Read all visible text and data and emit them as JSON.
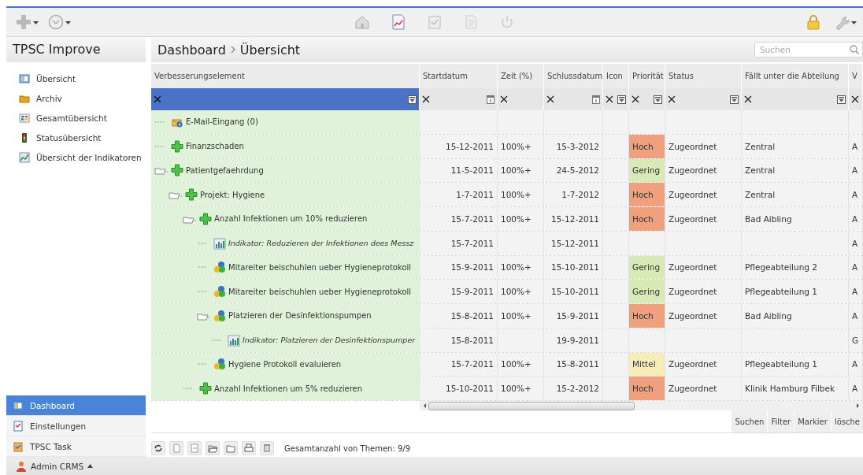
{
  "toolbar": {
    "left": [
      {
        "kind": "plus",
        "menu": true
      },
      {
        "kind": "clock",
        "menu": true
      }
    ],
    "center": [
      {
        "kind": "home"
      },
      {
        "kind": "chart"
      },
      {
        "kind": "clipboard"
      },
      {
        "kind": "document"
      },
      {
        "kind": "power"
      }
    ],
    "right": [
      {
        "kind": "lock",
        "menu": false
      },
      {
        "kind": "wrench",
        "menu": true
      }
    ]
  },
  "sidebar": {
    "title": "TPSC Improve",
    "items": [
      {
        "label": "Übersicht",
        "kind": "overview"
      },
      {
        "label": "Archiv",
        "kind": "archive"
      },
      {
        "label": "Gesamtübersicht",
        "kind": "grid"
      },
      {
        "label": "Statusübersicht",
        "kind": "traffic"
      },
      {
        "label": "Übersicht der Indikatoren",
        "kind": "chart"
      }
    ],
    "nav": [
      {
        "label": "Dashboard",
        "kind": "overview",
        "selected": true
      },
      {
        "label": "Einstellungen",
        "kind": "checklist",
        "selected": false
      },
      {
        "label": "TPSC Task",
        "kind": "task",
        "selected": false
      }
    ]
  },
  "breadcrumb": [
    "Dashboard",
    "Übersicht"
  ],
  "search": {
    "placeholder": "Suchen"
  },
  "table": {
    "columns": [
      {
        "label": "Verbesserungselement",
        "kind": "list",
        "selected": true
      },
      {
        "label": "Startdatum",
        "kind": "date",
        "selected": false
      },
      {
        "label": "Zeit (%)",
        "kind": "text",
        "selected": false
      },
      {
        "label": "Schlussdatum",
        "kind": "date",
        "selected": false
      },
      {
        "label": "Icon",
        "kind": "list",
        "selected": false
      },
      {
        "label": "Priorität",
        "kind": "list",
        "selected": false
      },
      {
        "label": "Status",
        "kind": "list",
        "selected": false
      },
      {
        "label": "Fällt unter die Abteilung",
        "kind": "list",
        "selected": false
      },
      {
        "label": "V",
        "kind": "text",
        "selected": false
      }
    ],
    "rows": [
      {
        "name": "E-Mail-Eingang (0)",
        "kind": "mail",
        "expanded": false
      },
      {
        "name": "Finanzschaden",
        "kind": "goal",
        "expanded": false,
        "start": "15-12-2011",
        "time": "100%+",
        "end": "15-3-2012",
        "priority": {
          "label": "Hoch",
          "color": "#f0a07c"
        },
        "status": "Zugeordnet",
        "department": "Zentral",
        "column_9": "A"
      },
      {
        "name": "Patientgefaehrdung",
        "kind": "goal",
        "expanded": true,
        "start": "11-5-2011",
        "time": "100%+",
        "end": "24-5-2012",
        "priority": {
          "label": "Gering",
          "color": "#d8eab6"
        },
        "status": "Zugeordnet",
        "department": "Zentral",
        "column_9": "A",
        "children": [
          {
            "name": "Projekt: Hygiene",
            "kind": "goal",
            "expanded": true,
            "start": "1-7-2011",
            "time": "100%+",
            "end": "1-7-2012",
            "priority": {
              "label": "Hoch",
              "color": "#f0a07c"
            },
            "status": "Zugeordnet",
            "department": "Zentral",
            "column_9": "A",
            "children": [
              {
                "name": "Anzahl Infektionen um 10% reduzieren",
                "kind": "goal",
                "expanded": true,
                "start": "15-7-2011",
                "time": "100%+",
                "end": "15-12-2011",
                "priority": {
                  "label": "Hoch",
                  "color": "#f0a07c"
                },
                "status": "Zugeordnet",
                "department": "Bad Aibling",
                "column_9": "A",
                "children": [
                  {
                    "name": "Indikator: Reduzieren der Infektionen dees Messz",
                    "kind": "indicator",
                    "expanded": false,
                    "start": "15-7-2011",
                    "end": "15-12-2011",
                    "column_9": "A"
                  },
                  {
                    "name": "Mitareiter beischuhlen ueber Hygieneprotokoll",
                    "kind": "task",
                    "expanded": false,
                    "start": "15-9-2011",
                    "time": "100%+",
                    "end": "15-10-2011",
                    "priority": {
                      "label": "Gering",
                      "color": "#d8eab6"
                    },
                    "status": "Zugeordnet",
                    "department": "Pflegeabteilung 2",
                    "column_9": "A"
                  },
                  {
                    "name": "Mitareiter beischuhlen ueber Hygieneprotokoll",
                    "kind": "task",
                    "expanded": false,
                    "start": "15-9-2011",
                    "time": "100%+",
                    "end": "15-10-2011",
                    "priority": {
                      "label": "Gering",
                      "color": "#d8eab6"
                    },
                    "status": "Zugeordnet",
                    "department": "Pflegeabteilung 1",
                    "column_9": "A"
                  },
                  {
                    "name": "Platzieren der Desinfektionspumpen",
                    "kind": "task",
                    "expanded": true,
                    "start": "15-8-2011",
                    "time": "100%+",
                    "end": "15-9-2011",
                    "priority": {
                      "label": "Hoch",
                      "color": "#f0a07c"
                    },
                    "status": "Zugeordnet",
                    "department": "Bad Aibling",
                    "column_9": "A",
                    "children": [
                      {
                        "name": "Indikator: Platzieren der Desinfektionspumper",
                        "kind": "indicator",
                        "expanded": false,
                        "start": "15-8-2011",
                        "end": "19-9-2011",
                        "column_9": "G"
                      }
                    ]
                  },
                  {
                    "name": "Hygiene Protokoll evaluieren",
                    "kind": "task",
                    "expanded": false,
                    "start": "15-7-2011",
                    "time": "100%+",
                    "end": "15-8-2011",
                    "priority": {
                      "label": "Mittel",
                      "color": "#f7edb8"
                    },
                    "status": "Zugeordnet",
                    "department": "Pflegeabteilung 1",
                    "column_9": "A"
                  }
                ]
              },
              {
                "name": "Anzahl Infektionen um 5% reduzieren",
                "kind": "goal",
                "expanded": false,
                "start": "15-10-2011",
                "time": "100%+",
                "end": "15-2-2012",
                "priority": {
                  "label": "Hoch",
                  "color": "#f0a07c"
                },
                "status": "Zugeordnet",
                "department": "Klinik Hamburg Filbek",
                "column_9": "A"
              }
            ]
          }
        ]
      }
    ]
  },
  "grid_buttons": [
    "Suchen",
    "Filter",
    "Markier",
    "lösche"
  ],
  "status_bar": {
    "tools": [
      {
        "kind": "refresh"
      },
      {
        "kind": "document"
      },
      {
        "kind": "export"
      },
      {
        "kind": "folder-open"
      },
      {
        "kind": "folder"
      },
      {
        "kind": "print"
      },
      {
        "kind": "delete"
      }
    ],
    "text": "Gesamtanzahl von Themen: 9/9"
  },
  "user": {
    "label": "Admin CRMS",
    "menu": true
  }
}
